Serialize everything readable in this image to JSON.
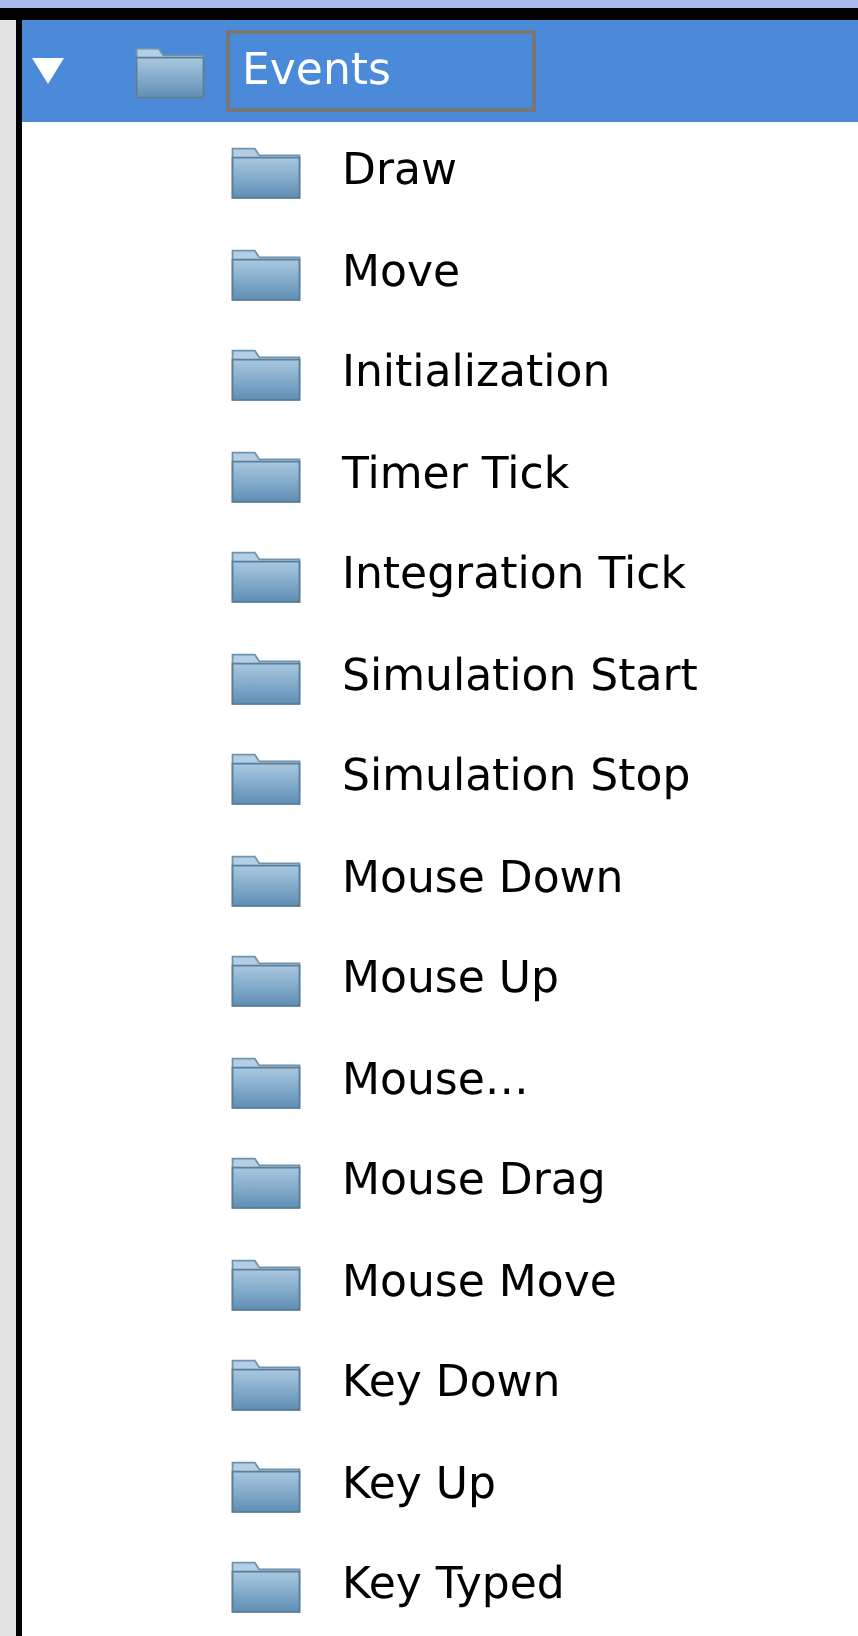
{
  "tree": [
    {
      "label": "Events",
      "expanded": true,
      "selected": true,
      "children": [
        {
          "label": "Draw",
          "selected": false
        },
        {
          "label": "Move",
          "selected": false
        },
        {
          "label": "Initialization",
          "selected": false
        },
        {
          "label": "Timer Tick",
          "selected": false
        },
        {
          "label": "Integration Tick",
          "selected": false
        },
        {
          "label": "Simulation Start",
          "selected": false
        },
        {
          "label": "Simulation Stop",
          "selected": false
        },
        {
          "label": "Mouse Down",
          "selected": false
        },
        {
          "label": "Mouse Up",
          "selected": false
        },
        {
          "label": "Mouse…",
          "selected": false
        },
        {
          "label": "Mouse Drag",
          "selected": false
        },
        {
          "label": "Mouse Move",
          "selected": false
        },
        {
          "label": "Key Down",
          "selected": false
        },
        {
          "label": "Key Up",
          "selected": false
        },
        {
          "label": "Key Typed",
          "selected": false
        }
      ]
    }
  ]
}
